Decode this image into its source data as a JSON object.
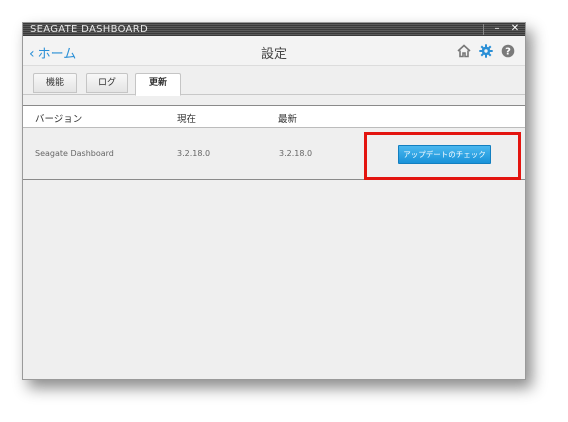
{
  "window": {
    "title": "SEAGATE DASHBOARD",
    "minimize_glyph": "–",
    "close_glyph": "✕"
  },
  "nav": {
    "back_label": "ホーム",
    "page_title": "設定",
    "icons": [
      "home-icon",
      "gear-icon",
      "help-icon"
    ],
    "accent_color": "#2a8fd6"
  },
  "tabs": [
    {
      "label": "機能",
      "active": false
    },
    {
      "label": "ログ",
      "active": false
    },
    {
      "label": "更新",
      "active": true
    }
  ],
  "table": {
    "headers": [
      "バージョン",
      "現在",
      "最新"
    ],
    "rows": [
      {
        "name": "Seagate Dashboard",
        "current": "3.2.18.0",
        "latest": "3.2.18.0"
      }
    ]
  },
  "update_button_label": "アップデートのチェック",
  "highlight_color": "#e3140f"
}
